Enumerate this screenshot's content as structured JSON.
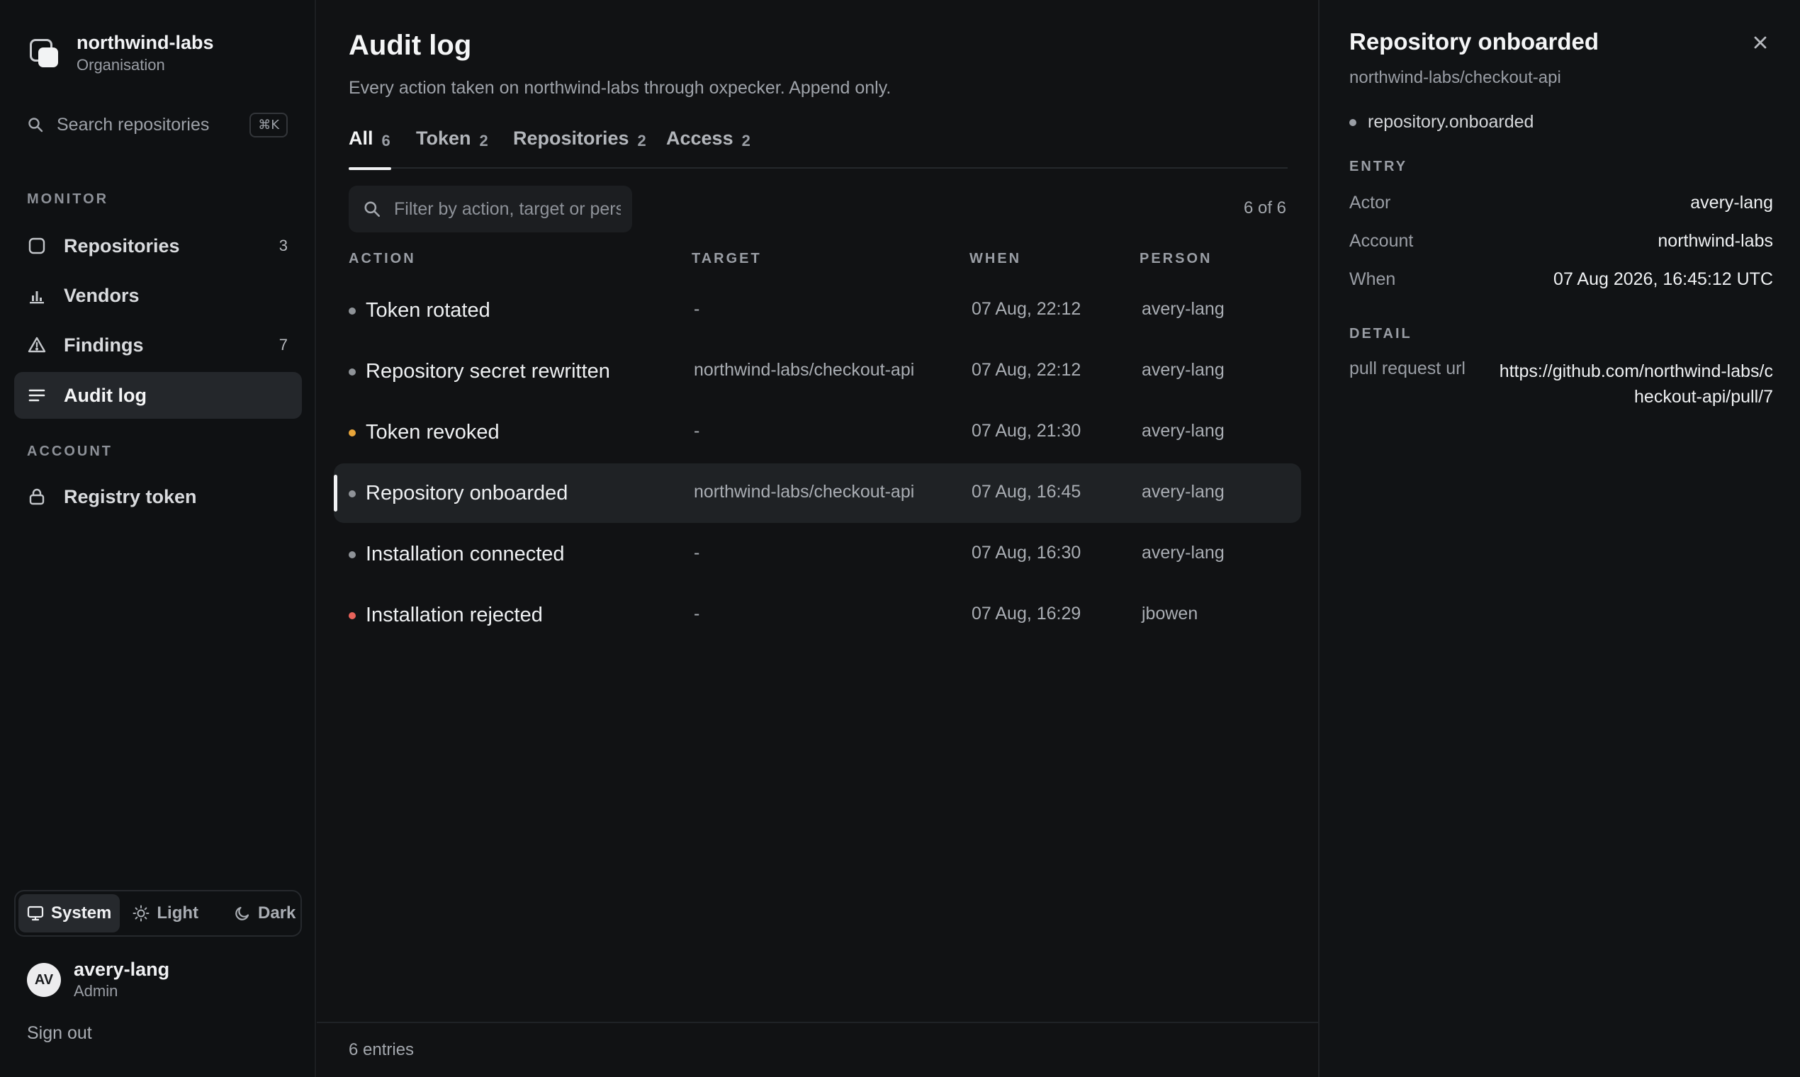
{
  "org": {
    "name": "northwind-labs",
    "type": "Organisation"
  },
  "search": {
    "placeholder": "Search repositories",
    "shortcut": "⌘K"
  },
  "sidebar": {
    "monitor_label": "MONITOR",
    "monitor_items": [
      {
        "label": "Repositories",
        "count": "3",
        "icon": "square-icon"
      },
      {
        "label": "Vendors",
        "count": "",
        "icon": "bar-chart-icon"
      },
      {
        "label": "Findings",
        "count": "7",
        "icon": "warning-icon"
      },
      {
        "label": "Audit log",
        "count": "",
        "icon": "list-icon",
        "active": true
      }
    ],
    "account_label": "ACCOUNT",
    "account_items": [
      {
        "label": "Registry token",
        "icon": "lock-icon"
      }
    ]
  },
  "theme": {
    "options": [
      "System",
      "Light",
      "Dark"
    ],
    "selected": "System"
  },
  "user": {
    "initials": "AV",
    "name": "avery-lang",
    "role": "Admin",
    "signout": "Sign out"
  },
  "page": {
    "title": "Audit log",
    "subtitle": "Every action taken on northwind-labs through oxpecker. Append only."
  },
  "tabs": [
    {
      "label": "All",
      "count": "6",
      "active": true
    },
    {
      "label": "Token",
      "count": "2"
    },
    {
      "label": "Repositories",
      "count": "2"
    },
    {
      "label": "Access",
      "count": "2"
    }
  ],
  "filter": {
    "placeholder": "Filter by action, target or person",
    "result_count": "6 of 6"
  },
  "table": {
    "columns": [
      "ACTION",
      "TARGET",
      "WHEN",
      "PERSON"
    ],
    "rows": [
      {
        "action": "Token rotated",
        "target": "-",
        "when": "07 Aug, 22:12",
        "person": "avery-lang",
        "status": "neutral"
      },
      {
        "action": "Repository secret rewritten",
        "target": "northwind-labs/checkout-api",
        "when": "07 Aug, 22:12",
        "person": "avery-lang",
        "status": "neutral"
      },
      {
        "action": "Token revoked",
        "target": "-",
        "when": "07 Aug, 21:30",
        "person": "avery-lang",
        "status": "warning"
      },
      {
        "action": "Repository onboarded",
        "target": "northwind-labs/checkout-api",
        "when": "07 Aug, 16:45",
        "person": "avery-lang",
        "status": "neutral",
        "selected": true
      },
      {
        "action": "Installation connected",
        "target": "-",
        "when": "07 Aug, 16:30",
        "person": "avery-lang",
        "status": "neutral"
      },
      {
        "action": "Installation rejected",
        "target": "-",
        "when": "07 Aug, 16:29",
        "person": "jbowen",
        "status": "error"
      }
    ]
  },
  "footer": {
    "entries": "6 entries"
  },
  "detail": {
    "title": "Repository onboarded",
    "subtitle": "northwind-labs/checkout-api",
    "event": "repository.onboarded",
    "entry_label": "ENTRY",
    "entry": [
      {
        "key": "Actor",
        "value": "avery-lang"
      },
      {
        "key": "Account",
        "value": "northwind-labs"
      },
      {
        "key": "When",
        "value": "07 Aug 2026, 16:45:12 UTC"
      }
    ],
    "detail_label": "DETAIL",
    "detail_fields": [
      {
        "key": "pull request url",
        "value": "https://github.com/northwind-labs/checkout-api/pull/7"
      }
    ]
  },
  "colors": {
    "neutral": "#8f9398",
    "warning": "#e8a53a",
    "error": "#e8625a"
  }
}
